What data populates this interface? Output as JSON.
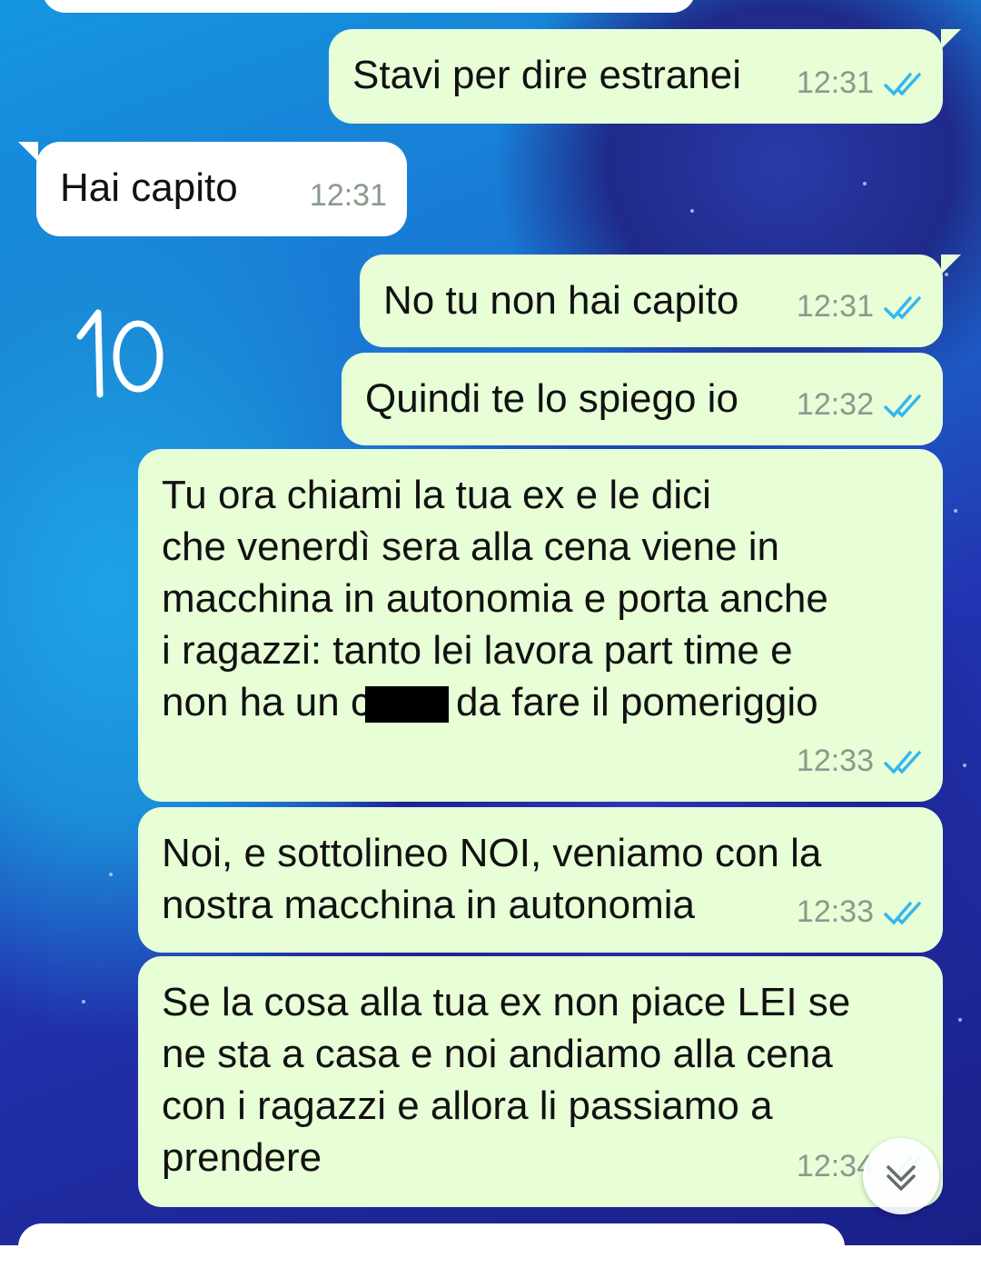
{
  "colors": {
    "outgoing_bubble": "#e7fed7",
    "incoming_bubble": "#ffffff",
    "read_ticks": "#34b7f1",
    "time_text": "#8a9a8c"
  },
  "annotation": {
    "text": "10"
  },
  "messages": [
    {
      "text": "Stavi per dire estranei",
      "time": "12:31",
      "direction": "outgoing",
      "status": "read"
    },
    {
      "text": "Hai capito",
      "time": "12:31",
      "direction": "incoming"
    },
    {
      "text": "No tu non hai capito",
      "time": "12:31",
      "direction": "outgoing",
      "status": "read"
    },
    {
      "text": "Quindi te lo spiego io",
      "time": "12:32",
      "direction": "outgoing",
      "status": "read"
    },
    {
      "line1": "Tu ora chiami la tua ex e le dici",
      "line2": "che venerdì sera alla cena viene in",
      "line3": "macchina in autonomia e porta anche",
      "line4": "i ragazzi: tanto lei lavora part time e",
      "line5_before": "non ha un c",
      "line5_after": "da fare il pomeriggio",
      "time": "12:33",
      "direction": "outgoing",
      "status": "read"
    },
    {
      "text": "Noi, e sottolineo NOI, veniamo con la\nnostra macchina in autonomia",
      "time": "12:33",
      "direction": "outgoing",
      "status": "read"
    },
    {
      "text": "Se la cosa alla tua ex non piace LEI se\nne sta a casa e noi andiamo alla cena\ncon i ragazzi e allora li passiamo a\nprendere",
      "time": "12:34",
      "direction": "outgoing",
      "status": "read"
    }
  ],
  "scroll_button": {
    "icon": "chevron-down-icon"
  }
}
